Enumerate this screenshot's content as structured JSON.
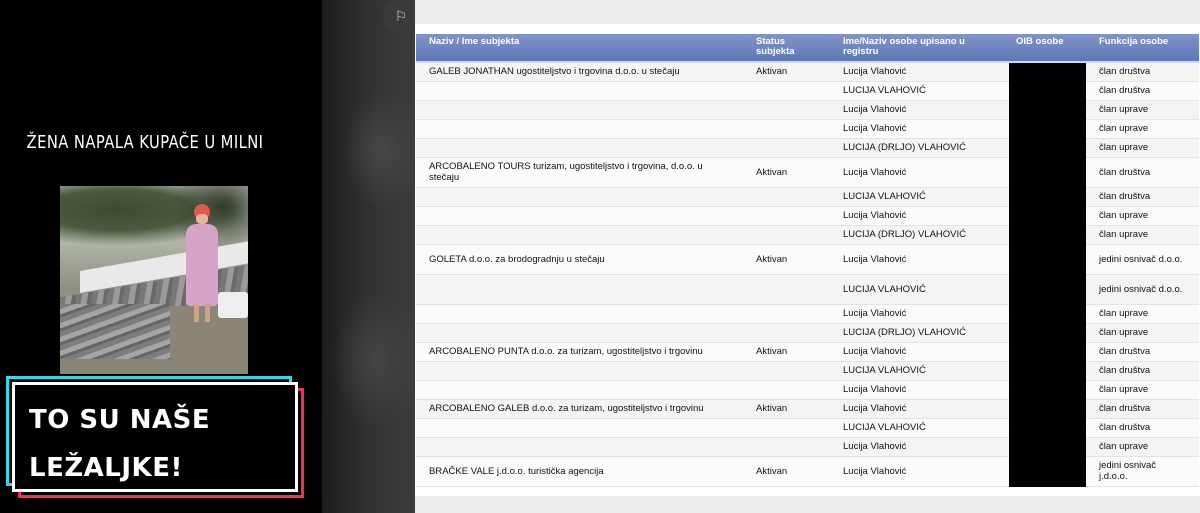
{
  "video": {
    "title": "ŽENA NAPALA KUPAČE U MILNI",
    "caption_line1": "TO SU NAŠE",
    "caption_line2": "LEŽALJKE!"
  },
  "flag_icon_glyph": "⚐",
  "table": {
    "headers": {
      "naziv": "Naziv / Ime subjekta",
      "status": "Status subjekta",
      "ime": "Ime/Naziv osobe upisano u registru",
      "oib": "OIB osobe",
      "funkcija": "Funkcija osobe"
    },
    "rows": [
      {
        "naziv": "GALEB JONATHAN ugostiteljstvo i trgovina d.o.o. u stečaju",
        "status": "Aktivan",
        "ime": "Lucija Vlahović",
        "funkcija": "član društva"
      },
      {
        "naziv": "",
        "status": "",
        "ime": "LUCIJA VLAHOVIĆ",
        "funkcija": "član društva"
      },
      {
        "naziv": "",
        "status": "",
        "ime": "Lucija Vlahović",
        "funkcija": "član uprave"
      },
      {
        "naziv": "",
        "status": "",
        "ime": "Lucija Vlahović",
        "funkcija": "član uprave"
      },
      {
        "naziv": "",
        "status": "",
        "ime": "LUCIJA (DRLJO) VLAHOVIĆ",
        "funkcija": "član uprave"
      },
      {
        "naziv": "ARCOBALENO TOURS turizam, ugostiteljstvo i trgovina, d.o.o. u stečaju",
        "status": "Aktivan",
        "ime": "Lucija Vlahović",
        "funkcija": "član društva"
      },
      {
        "naziv": "",
        "status": "",
        "ime": "LUCIJA VLAHOVIĆ",
        "funkcija": "član društva"
      },
      {
        "naziv": "",
        "status": "",
        "ime": "Lucija Vlahović",
        "funkcija": "član uprave"
      },
      {
        "naziv": "",
        "status": "",
        "ime": "LUCIJA (DRLJO) VLAHOVIĆ",
        "funkcija": "član uprave"
      },
      {
        "naziv": "GOLETA d.o.o. za brodogradnju u stečaju",
        "status": "Aktivan",
        "ime": "Lucija Vlahović",
        "funkcija": "jedini osnivač d.o.o."
      },
      {
        "naziv": "",
        "status": "",
        "ime": "LUCIJA VLAHOVIĆ",
        "funkcija": "jedini osnivač d.o.o."
      },
      {
        "naziv": "",
        "status": "",
        "ime": "Lucija Vlahović",
        "funkcija": "član uprave"
      },
      {
        "naziv": "",
        "status": "",
        "ime": "LUCIJA (DRLJO) VLAHOVIĆ",
        "funkcija": "član uprave"
      },
      {
        "naziv": "ARCOBALENO PUNTA d.o.o. za turizam, ugostiteljstvo i trgovinu",
        "status": "Aktivan",
        "ime": "Lucija Vlahović",
        "funkcija": "član društva"
      },
      {
        "naziv": "",
        "status": "",
        "ime": "LUCIJA VLAHOVIĆ",
        "funkcija": "član društva"
      },
      {
        "naziv": "",
        "status": "",
        "ime": "Lucija Vlahović",
        "funkcija": "član uprave"
      },
      {
        "naziv": "ARCOBALENO GALEB d.o.o. za turizam, ugostiteljstvo i trgovinu",
        "status": "Aktivan",
        "ime": "Lucija Vlahović",
        "funkcija": "član društva"
      },
      {
        "naziv": "",
        "status": "",
        "ime": "LUCIJA VLAHOVIĆ",
        "funkcija": "član društva"
      },
      {
        "naziv": "",
        "status": "",
        "ime": "Lucija Vlahović",
        "funkcija": "član uprave"
      },
      {
        "naziv": "BRAČKE VALE j.d.o.o. turistička agencija",
        "status": "Aktivan",
        "ime": "Lucija Vlahović",
        "funkcija": "jedini osnivač j.d.o.o."
      }
    ]
  },
  "colors": {
    "header_blue": "#6a82bd",
    "caption_cyan": "#34d7e4",
    "caption_pink": "#ff2a5a"
  }
}
